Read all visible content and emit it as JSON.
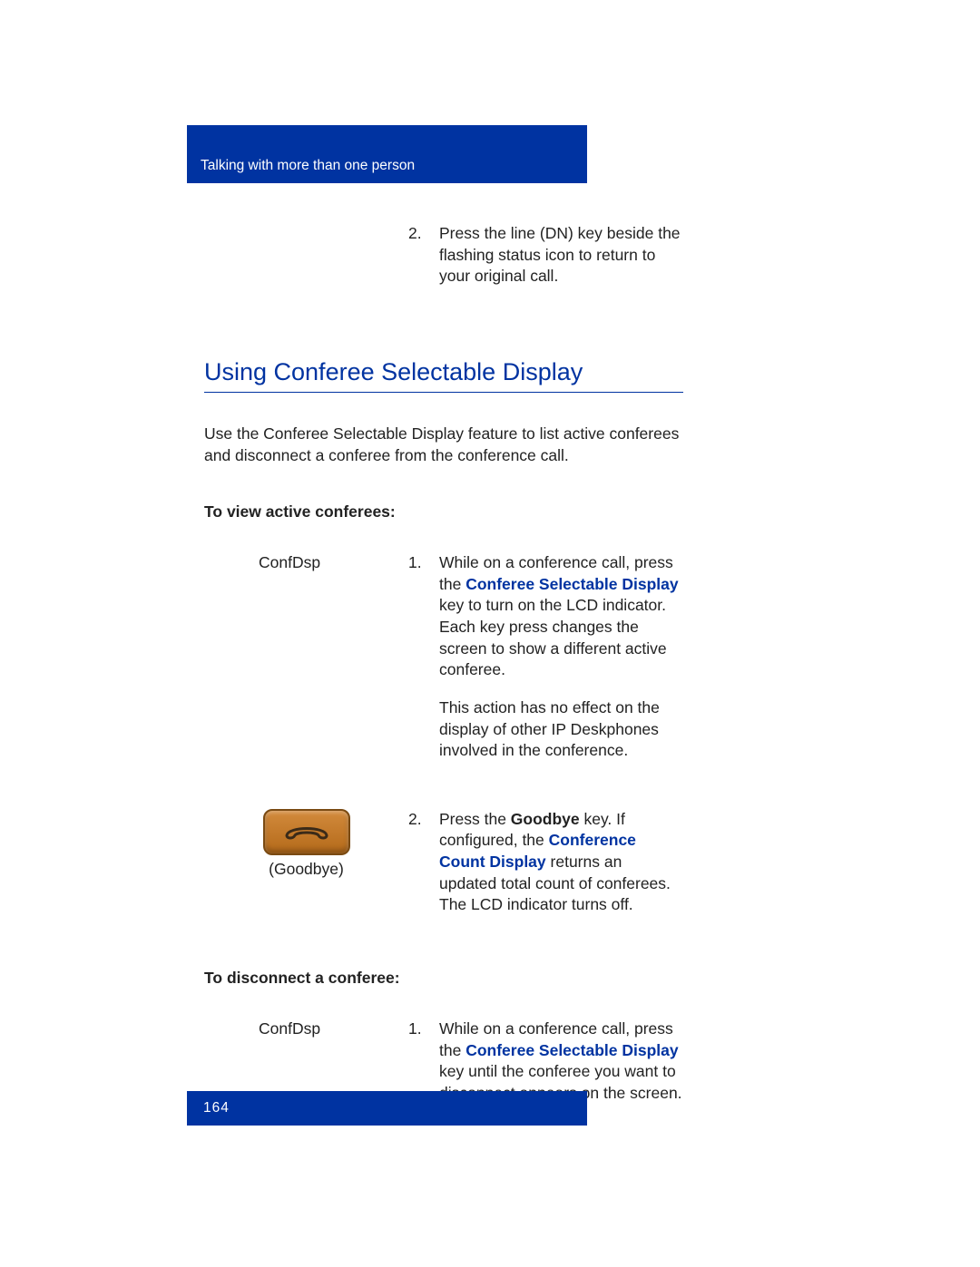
{
  "header": {
    "chapter_title": "Talking with more than one person"
  },
  "top_step": {
    "num": "2.",
    "text": "Press the line (DN) key beside the flashing status icon to return to your original call."
  },
  "section_title": "Using Conferee Selectable Display",
  "intro": "Use the Conferee Selectable Display feature to list active conferees and disconnect a conferee from the conference call.",
  "view": {
    "heading": "To view active conferees:",
    "key_label": "ConfDsp",
    "step1_num": "1.",
    "step1_pre": "While on a conference call, press the ",
    "step1_key": "Conferee Selectable Display",
    "step1_post": " key to turn on the LCD indicator. Each key press changes the screen to show a different active conferee.",
    "step1_note": "This action has no effect on the display of other IP Deskphones involved in the conference.",
    "goodbye_label": "(Goodbye)",
    "step2_num": "2.",
    "step2_a": "Press the ",
    "step2_goodbye": "Goodbye",
    "step2_b": " key. If configured, the ",
    "step2_count": "Conference Count Display",
    "step2_c": " returns an updated total count of conferees. The LCD indicator turns off."
  },
  "disc": {
    "heading": "To disconnect a conferee:",
    "key_label": "ConfDsp",
    "step1_num": "1.",
    "step1_pre": "While on a conference call, press the ",
    "step1_key": "Conferee Selectable Display",
    "step1_post": " key until the conferee you want to disconnect appears on the screen."
  },
  "footer": {
    "page_number": "164"
  }
}
